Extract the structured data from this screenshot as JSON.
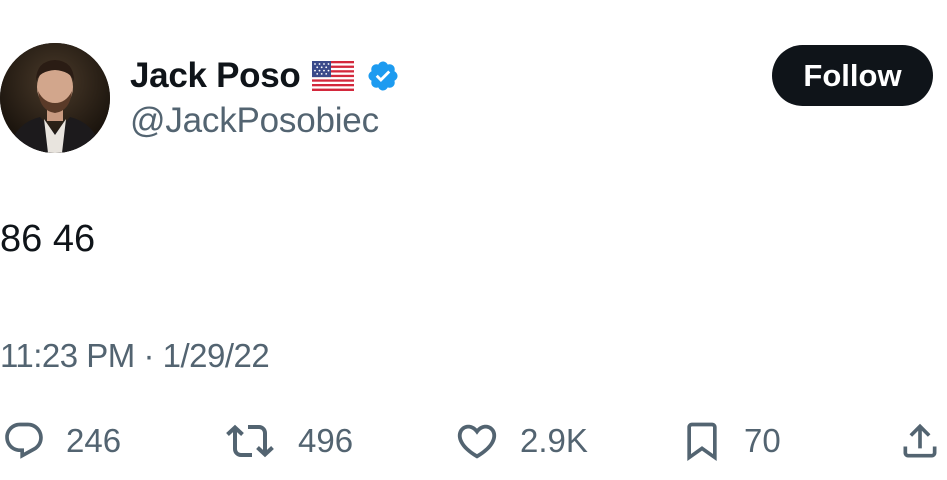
{
  "author": {
    "display_name": "Jack Poso",
    "handle": "@JackPosobiec",
    "flag_icon": "us-flag-icon",
    "verified_icon": "verified-badge-icon",
    "verified_color": "#1d9bf0"
  },
  "follow_label": "Follow",
  "tweet": {
    "text": "86 46",
    "timestamp": "11:23 PM · 1/29/22"
  },
  "actions": {
    "replies": {
      "icon": "reply-icon",
      "count": "246"
    },
    "reposts": {
      "icon": "repost-icon",
      "count": "496"
    },
    "likes": {
      "icon": "heart-icon",
      "count": "2.9K"
    },
    "bookmarks": {
      "icon": "bookmark-icon",
      "count": "70"
    },
    "share": {
      "icon": "share-icon"
    }
  },
  "colors": {
    "text_primary": "#0f1419",
    "text_secondary": "#536471",
    "follow_bg": "#0f1419",
    "follow_text": "#ffffff"
  }
}
